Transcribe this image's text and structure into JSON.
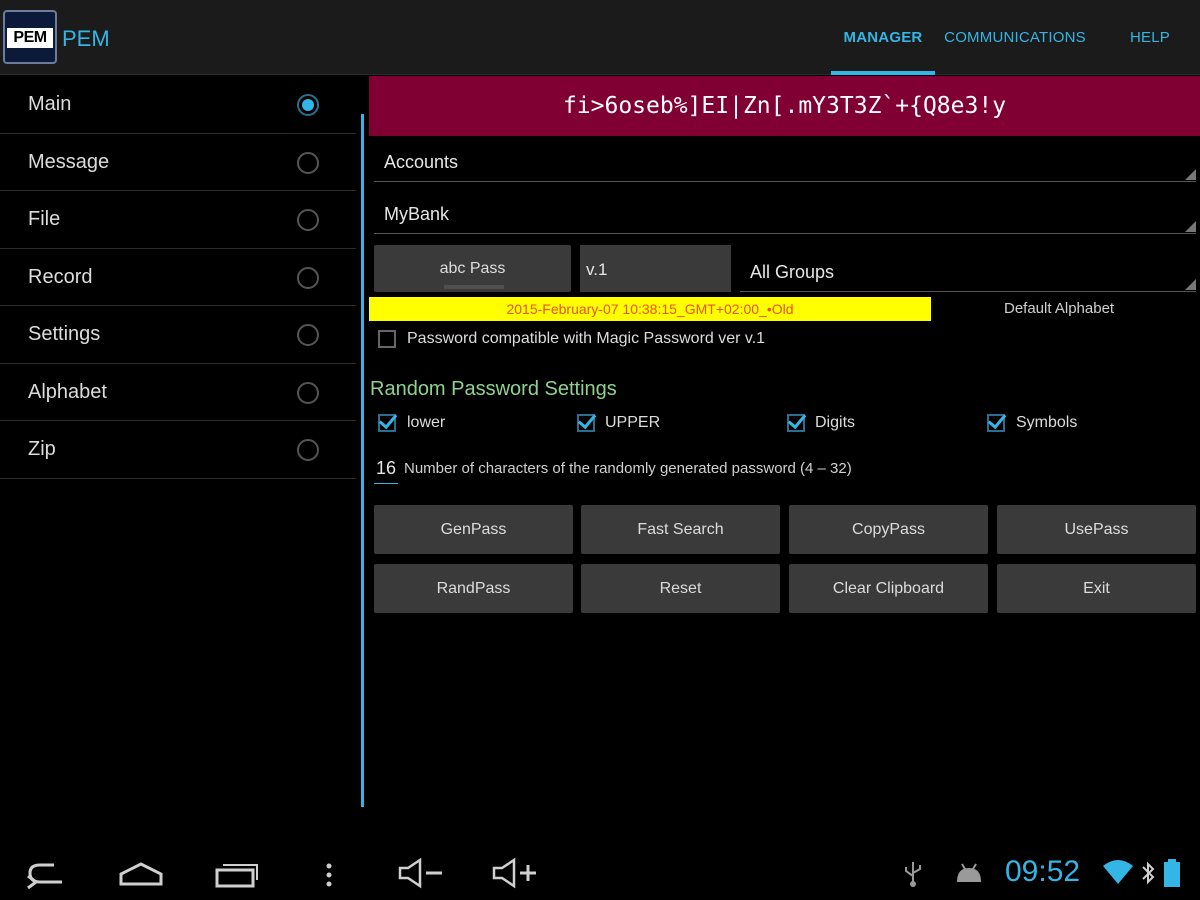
{
  "app": {
    "logo_text": "PEM",
    "title": "PEM",
    "tabs": [
      {
        "label": "MANAGER",
        "active": true
      },
      {
        "label": "COMMUNICATIONS",
        "active": false
      },
      {
        "label": "HELP",
        "active": false
      }
    ],
    "accent_color": "#33b5e5"
  },
  "sidebar": {
    "items": [
      {
        "label": "Main",
        "selected": true
      },
      {
        "label": "Message",
        "selected": false
      },
      {
        "label": "File",
        "selected": false
      },
      {
        "label": "Record",
        "selected": false
      },
      {
        "label": "Settings",
        "selected": false
      },
      {
        "label": "Alphabet",
        "selected": false
      },
      {
        "label": "Zip",
        "selected": false
      }
    ]
  },
  "main": {
    "generated_password": "fi>6oseb%]EI|Zn[.mY3T3Z`+{Q8e3!y",
    "banner_color": "#800034",
    "accounts_spinner": "Accounts",
    "account_spinner": "MyBank",
    "abc_pass_button": "abc Pass",
    "version_field": "v.1",
    "groups_spinner": "All Groups",
    "date_label": "2015-February-07 10:38:15_GMT+02:00_•Old",
    "default_alphabet": "Default Alphabet",
    "magic_compat_label": "Password compatible with Magic Password ver v.1",
    "magic_compat_checked": false,
    "random_settings_title": "Random Password Settings",
    "options": [
      {
        "label": "lower",
        "checked": true
      },
      {
        "label": "UPPER",
        "checked": true
      },
      {
        "label": "Digits",
        "checked": true
      },
      {
        "label": "Symbols",
        "checked": true
      }
    ],
    "char_count": "16",
    "char_count_label": "Number of characters of the randomly generated password (4 – 32)",
    "buttons": [
      "GenPass",
      "Fast Search",
      "CopyPass",
      "UsePass",
      "RandPass",
      "Reset",
      "Clear Clipboard",
      "Exit"
    ]
  },
  "system_bar": {
    "clock": "09:52",
    "icons": [
      "back-icon",
      "home-icon",
      "recent-apps-icon",
      "menu-icon",
      "volume-down-icon",
      "volume-up-icon",
      "usb-icon",
      "android-debug-icon",
      "wifi-icon",
      "bluetooth-icon",
      "battery-icon"
    ]
  }
}
